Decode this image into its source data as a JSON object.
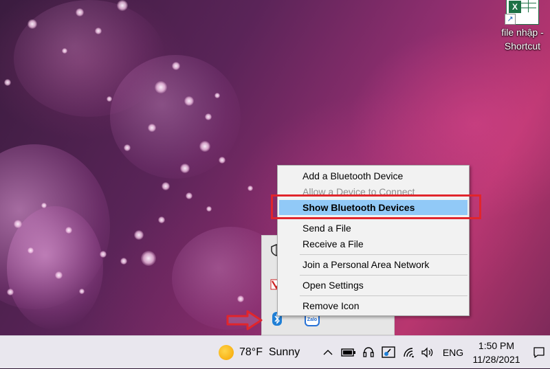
{
  "desktop": {
    "shortcut": {
      "icon": "excel-file-icon",
      "label_line1": "file nhập -",
      "label_line2": "Shortcut"
    }
  },
  "context_menu": {
    "items": [
      {
        "label": "Add a Bluetooth Device",
        "enabled": true
      },
      {
        "label": "Allow a Device to Connect",
        "enabled": false
      },
      {
        "label": "Show Bluetooth Devices",
        "enabled": true,
        "highlighted": true
      },
      {
        "label": "Send a File",
        "enabled": true
      },
      {
        "label": "Receive a File",
        "enabled": true
      },
      {
        "label": "Join a Personal Area Network",
        "enabled": true
      },
      {
        "label": "Open Settings",
        "enabled": true
      },
      {
        "label": "Remove Icon",
        "enabled": true
      }
    ],
    "highlight_color": "#91c9f7",
    "annotation_color": "#e1252c"
  },
  "tray_overflow": {
    "icons": [
      "shield-icon",
      "antivirus-icon",
      "bluetooth-icon",
      "zalo-icon"
    ]
  },
  "taskbar": {
    "weather": {
      "temperature": "78°F",
      "condition": "Sunny",
      "icon": "sun-icon"
    },
    "tray_icons": [
      "chevron-up-icon",
      "battery-icon",
      "headset-icon",
      "pen-tablet-icon",
      "wifi-icon",
      "volume-icon"
    ],
    "language": "ENG",
    "time": "1:50 PM",
    "date": "11/28/2021",
    "notification_icon": "notification-icon"
  }
}
